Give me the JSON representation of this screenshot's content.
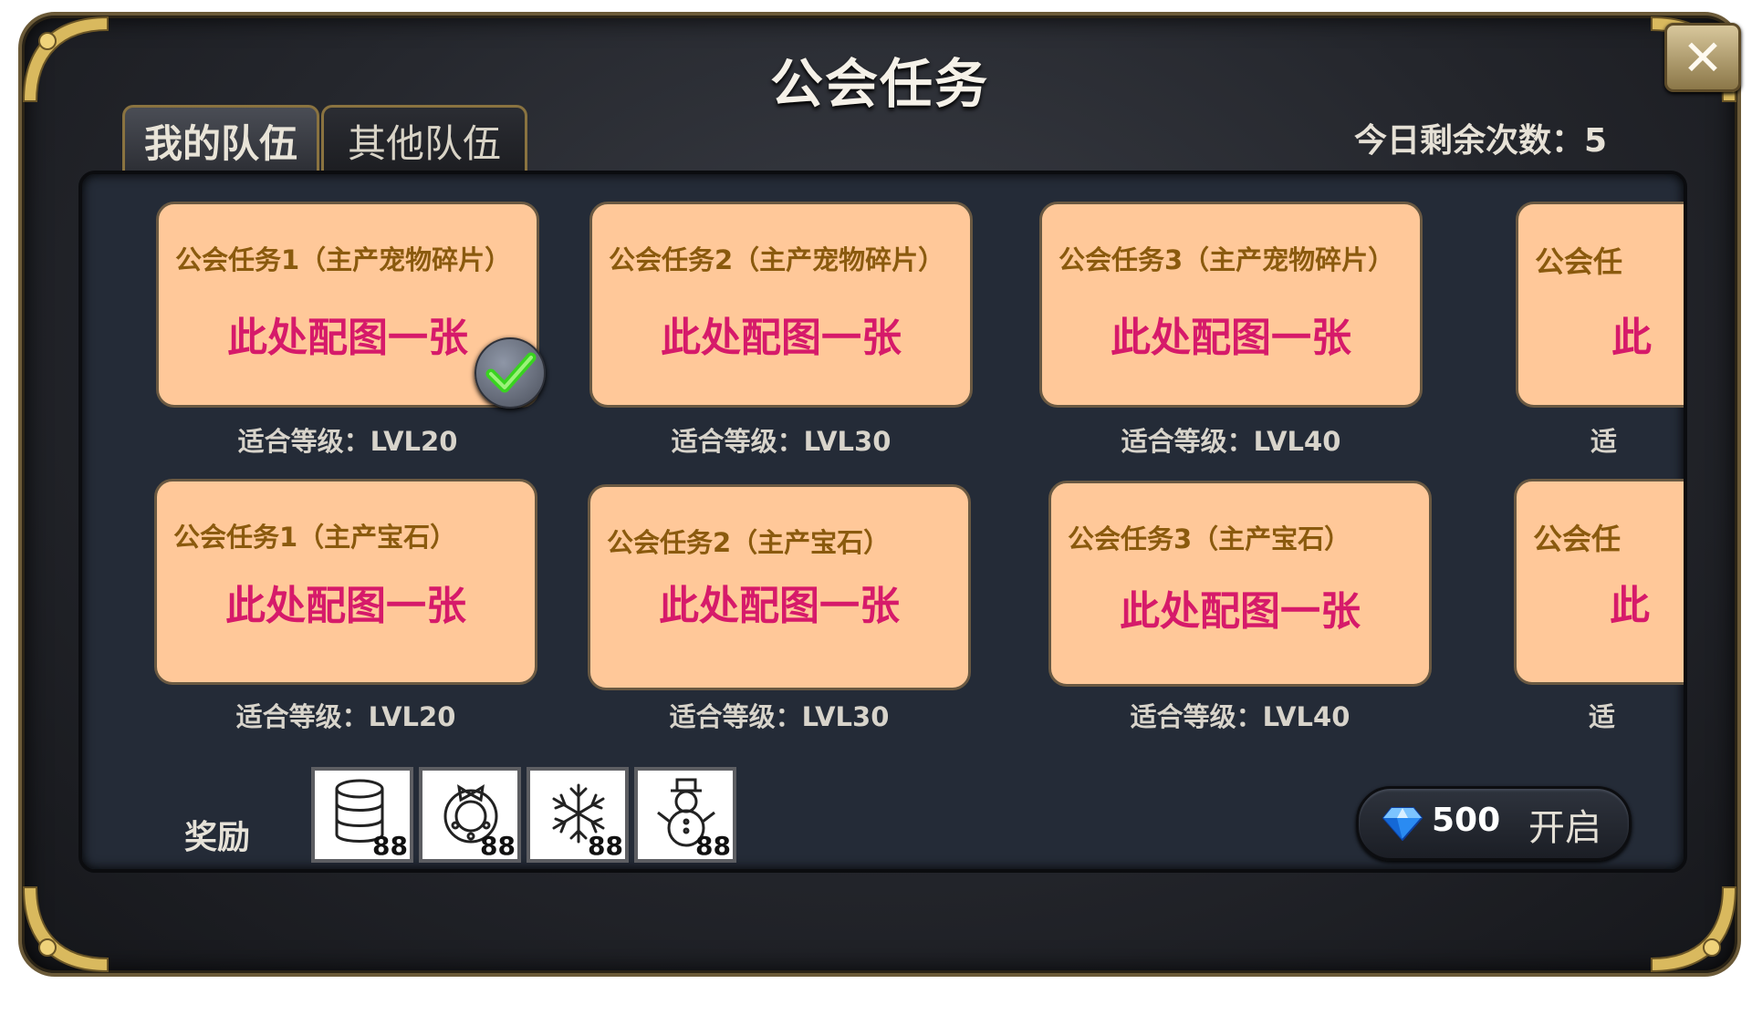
{
  "window": {
    "title": "公会任务",
    "close_icon": "close-icon"
  },
  "tabs": [
    {
      "label": "我的队伍",
      "active": true
    },
    {
      "label": "其他队伍",
      "active": false
    }
  ],
  "remaining": "今日剩余次数：5",
  "cards_row1": [
    {
      "title": "公会任务1（主产宠物碎片）",
      "image": "此处配图一张",
      "level": "适合等级：LVL20",
      "completed": true
    },
    {
      "title": "公会任务2（主产宠物碎片）",
      "image": "此处配图一张",
      "level": "适合等级：LVL30",
      "completed": false
    },
    {
      "title": "公会任务3（主产宠物碎片）",
      "image": "此处配图一张",
      "level": "适合等级：LVL40",
      "completed": false
    },
    {
      "title": "公会任",
      "image": "此",
      "level": "适",
      "completed": false
    }
  ],
  "cards_row2": [
    {
      "title": "公会任务1（主产宝石）",
      "image": "此处配图一张",
      "level": "适合等级：LVL20"
    },
    {
      "title": "公会任务2（主产宝石）",
      "image": "此处配图一张",
      "level": "适合等级：LVL30"
    },
    {
      "title": "公会任务3（主产宝石）",
      "image": "此处配图一张",
      "level": "适合等级：LVL40"
    },
    {
      "title": "公会任",
      "image": "此",
      "level": "适"
    }
  ],
  "rewards": {
    "label": "奖励",
    "items": [
      {
        "icon": "coin-stack-icon",
        "count": "88"
      },
      {
        "icon": "wreath-icon",
        "count": "88"
      },
      {
        "icon": "snowflake-icon",
        "count": "88"
      },
      {
        "icon": "snowman-icon",
        "count": "88"
      }
    ]
  },
  "start": {
    "gem_icon": "diamond-icon",
    "cost": "500",
    "label": "开启"
  },
  "colors": {
    "card_bg": "#ffc899",
    "card_title": "#8a5a0e",
    "placeholder": "#d61a6a",
    "frame_gold": "#8a7340"
  }
}
